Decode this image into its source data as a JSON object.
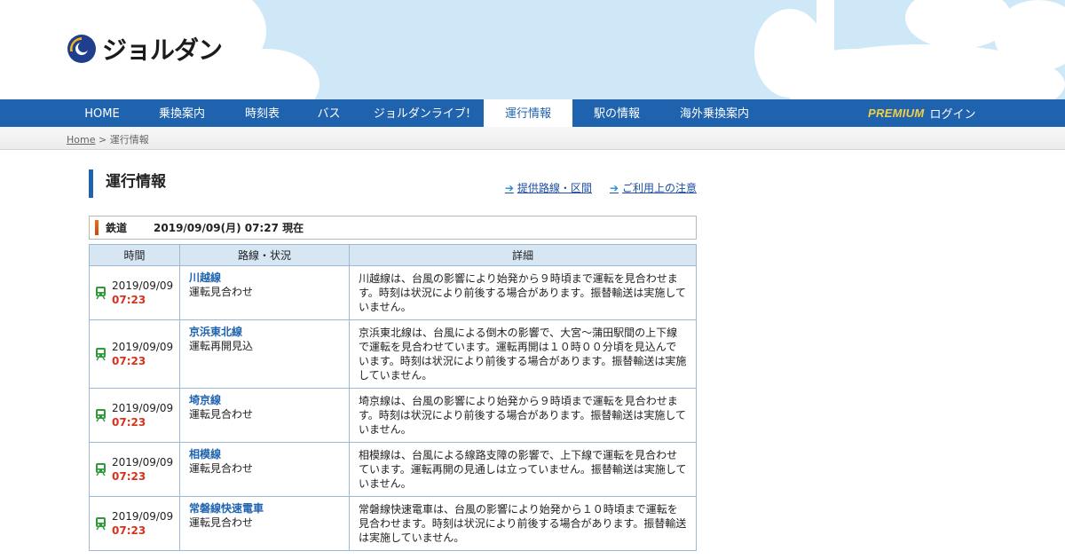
{
  "brand": {
    "name": "ジョルダン"
  },
  "nav": {
    "items": [
      {
        "label": "HOME"
      },
      {
        "label": "乗換案内"
      },
      {
        "label": "時刻表"
      },
      {
        "label": "バス"
      },
      {
        "label": "ジョルダンライブ!"
      },
      {
        "label": "運行情報"
      },
      {
        "label": "駅の情報"
      },
      {
        "label": "海外乗換案内"
      }
    ],
    "premium_label": "PREMIUM",
    "login_label": "ログイン"
  },
  "breadcrumb": {
    "home": "Home",
    "separator": ">",
    "current": "運行情報"
  },
  "page": {
    "title": "運行情報",
    "links": [
      "提供路線・区間",
      "ご利用上の注意"
    ]
  },
  "section": {
    "label": "鉄道",
    "timestamp": "2019/09/09(月) 07:27 現在"
  },
  "table": {
    "headers": [
      "時間",
      "路線・状況",
      "詳細"
    ],
    "rows": [
      {
        "date": "2019/09/09",
        "time": "07:23",
        "line": "川越線",
        "status": "運転見合わせ",
        "detail": "川越線は、台風の影響により始発から９時頃まで運転を見合わせます。時刻は状況により前後する場合があります。振替輸送は実施していません。"
      },
      {
        "date": "2019/09/09",
        "time": "07:23",
        "line": "京浜東北線",
        "status": "運転再開見込",
        "detail": "京浜東北線は、台風による倒木の影響で、大宮〜蒲田駅間の上下線で運転を見合わせています。運転再開は１０時００分頃を見込んでいます。時刻は状況により前後する場合があります。振替輸送は実施していません。"
      },
      {
        "date": "2019/09/09",
        "time": "07:23",
        "line": "埼京線",
        "status": "運転見合わせ",
        "detail": "埼京線は、台風の影響により始発から９時頃まで運転を見合わせます。時刻は状況により前後する場合があります。振替輸送は実施していません。"
      },
      {
        "date": "2019/09/09",
        "time": "07:23",
        "line": "相模線",
        "status": "運転見合わせ",
        "detail": "相模線は、台風による線路支障の影響で、上下線で運転を見合わせています。運転再開の見通しは立っていません。振替輸送は実施していません。"
      },
      {
        "date": "2019/09/09",
        "time": "07:23",
        "line": "常磐線快速電車",
        "status": "運転見合わせ",
        "detail": "常磐線快速電車は、台風の影響により始発から１０時頃まで運転を見合わせます。時刻は状況により前後する場合があります。振替輸送は実施していません。"
      }
    ]
  },
  "colors": {
    "nav_bg": "#1f63ae",
    "time_red": "#d8321e",
    "icon_green": "#2e9a3a"
  }
}
